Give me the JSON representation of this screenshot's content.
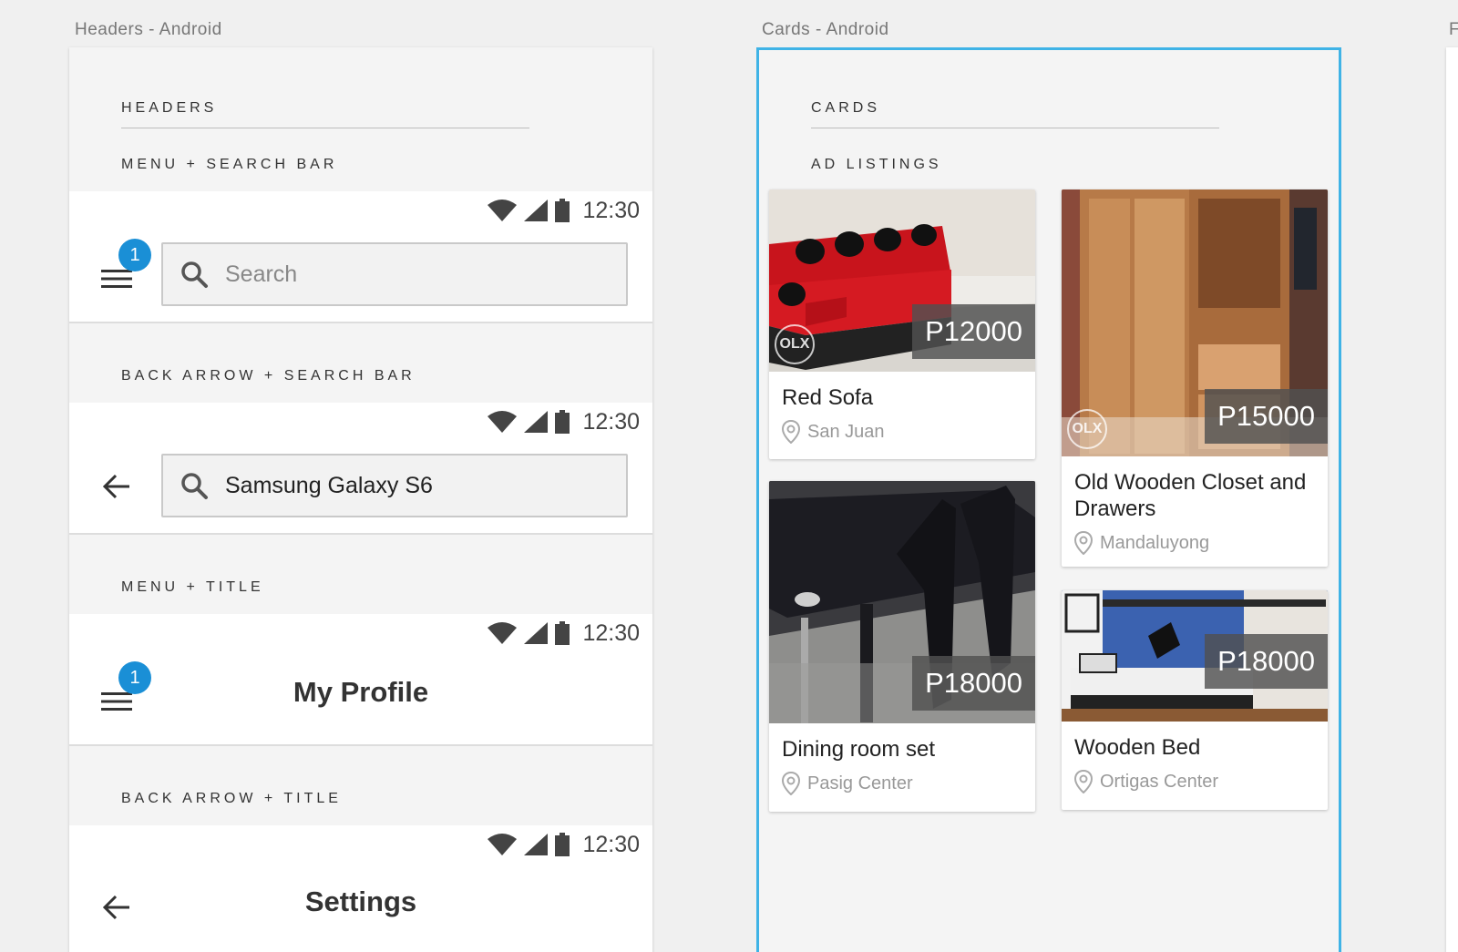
{
  "canvas": {
    "artboard_headers_label": "Headers - Android",
    "artboard_cards_label": "Cards - Android",
    "artboard_third_label": "F"
  },
  "headers": {
    "section_title": "HEADERS",
    "status_time": "12:30",
    "menu_search": {
      "subtitle": "MENU + SEARCH BAR",
      "badge_count": "1",
      "search_placeholder": "Search"
    },
    "back_search": {
      "subtitle": "BACK ARROW + SEARCH BAR",
      "search_value": "Samsung Galaxy S6"
    },
    "menu_title": {
      "subtitle": "MENU + TITLE",
      "badge_count": "1",
      "title": "My Profile"
    },
    "back_title": {
      "subtitle": "BACK ARROW + TITLE",
      "title": "Settings"
    }
  },
  "cards": {
    "section_title": "CARDS",
    "subtitle": "AD LISTINGS",
    "listings": [
      {
        "title": "Red Sofa",
        "price": "P12000",
        "location": "San Juan",
        "watermark": "OLX"
      },
      {
        "title": "Old Wooden Closet and Drawers",
        "price": "P15000",
        "location": "Mandaluyong",
        "watermark": "OLX"
      },
      {
        "title": "Dining room set",
        "price": "P18000",
        "location": "Pasig Center"
      },
      {
        "title": "Wooden Bed",
        "price": "P18000",
        "location": "Ortigas Center"
      }
    ]
  },
  "colors": {
    "badge": "#1a8fd6",
    "selection_border": "#3fb3e6",
    "price_tag": "#505050"
  },
  "icons": [
    "wifi-icon",
    "signal-icon",
    "battery-icon",
    "menu-icon",
    "search-icon",
    "back-arrow-icon",
    "location-pin-icon"
  ]
}
